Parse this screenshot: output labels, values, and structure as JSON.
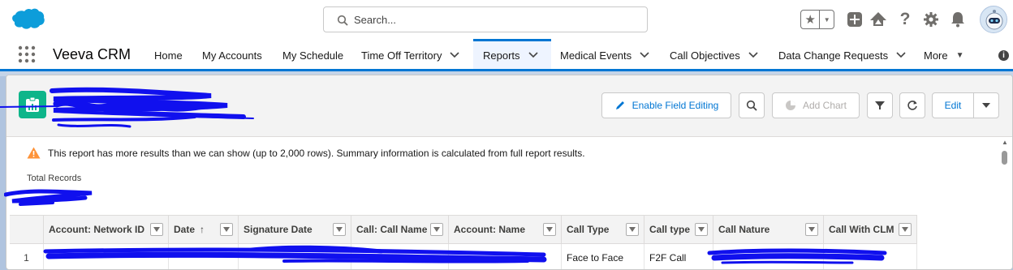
{
  "header": {
    "search_placeholder": "Search...",
    "icons": [
      "salesforce-cloud-logo",
      "favorites-star-icon",
      "favorites-dropdown-icon",
      "global-add-icon",
      "trailhead-icon",
      "help-icon",
      "setup-gear-icon",
      "notifications-bell-icon",
      "user-avatar"
    ]
  },
  "nav": {
    "app_name": "Veeva CRM",
    "items": [
      {
        "label": "Home"
      },
      {
        "label": "My Accounts"
      },
      {
        "label": "My Schedule"
      },
      {
        "label": "Time Off Territory"
      },
      {
        "label": "Reports"
      },
      {
        "label": "Medical Events"
      },
      {
        "label": "Call Objectives"
      },
      {
        "label": "Data Change Requests"
      },
      {
        "label": "More"
      }
    ],
    "active": "Reports"
  },
  "report": {
    "buttons": {
      "enable_field_editing": "Enable Field Editing",
      "add_chart": "Add Chart",
      "edit": "Edit"
    },
    "warning": "This report has more results than we can show (up to 2,000 rows). Summary information is calculated from full report results.",
    "total_records_label": "Total Records",
    "columns": [
      {
        "label": "Account: Network ID"
      },
      {
        "label": "Date",
        "sort": "↑"
      },
      {
        "label": "Signature Date"
      },
      {
        "label": "Call: Call Name"
      },
      {
        "label": "Account: Name"
      },
      {
        "label": "Call Type"
      },
      {
        "label": "Call type"
      },
      {
        "label": "Call Nature"
      },
      {
        "label": "Call With CLM"
      }
    ],
    "rows": [
      {
        "num": "1",
        "cells": [
          "",
          "",
          "",
          "",
          "",
          "Face to Face",
          "F2F Call",
          "",
          ""
        ]
      }
    ]
  },
  "colors": {
    "brand_blue": "#0176d3",
    "report_icon_green": "#0eb58a",
    "warning_orange": "#fe9339",
    "redaction_blue": "#1010ee",
    "page_band": "#b0c4df"
  }
}
